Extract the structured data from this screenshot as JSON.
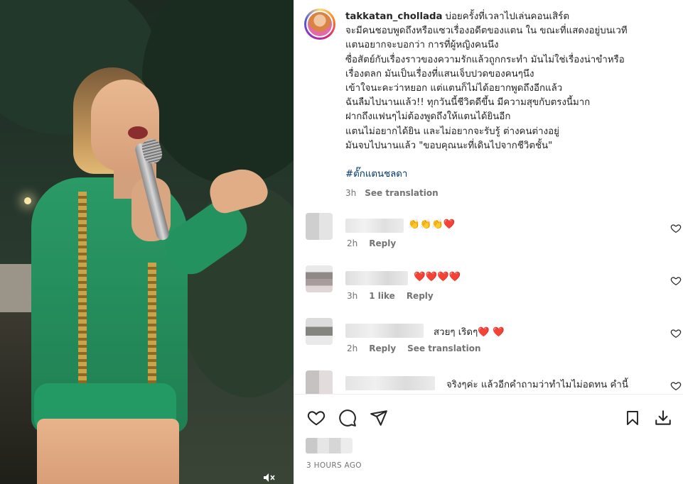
{
  "post": {
    "username": "takkatan_chollada",
    "caption_lines": [
      "บ่อยครั้งที่เวลาไปเล่นคอนเสิร์ต",
      "จะมีคนชอบพูดถึงหรือแซวเรื่องอดีตของแตน ใน ขณะที่แสดงอยู่บนเวที",
      "แตนอยากจะบอกว่า การที่ผู้หญิงคนนึง",
      "ซื่อสัตย์กับเรื่องราวของความรักแล้วถูกกระทำ มันไม่ใช่เรื่องน่าขำหรือ",
      "เรื่องตลก มันเป็นเรื่องที่แสนเจ็บปวดของคนๆนึง",
      "เข้าใจนะคะว่าหยอก แต่แตนก็ไม่ได้อยากพูดถึงอีกแล้ว",
      "ฉันลืมไปนานแล้ว!! ทุกวันนี้ชีวิตดีขึ้น มีความสุขกับตรงนี้มาก",
      "ฝากถึงแฟนๆไม่ต้องพูดถึงให้แตนได้ยินอีก",
      "แตนไม่อยากได้ยิน และไม่อยากจะรับรู้ ต่างคนต่างอยู่",
      "มันจบไปนานแล้ว \"ขอบคุณนะที่เดินไปจากชีวิตชั้น\""
    ],
    "hashtag": "#ตั๊กแตนชลดา",
    "time": "3h",
    "see_translation": "See translation",
    "posted_ago": "3 HOURS AGO"
  },
  "comments": [
    {
      "text": "👏👏👏❤️",
      "time": "2h",
      "likes": "",
      "reply": "Reply",
      "translate": ""
    },
    {
      "text": "❤️❤️❤️❤️",
      "time": "3h",
      "likes": "1 like",
      "reply": "Reply",
      "translate": ""
    },
    {
      "text": "สวยๆ เริดๆ❤️ ❤️",
      "time": "2h",
      "likes": "",
      "reply": "Reply",
      "translate": "See translation"
    },
    {
      "text": "จริงๆค่ะ แล้วอีกคำถามว่าทำไมไม่อดทน คำนี้",
      "time": "",
      "likes": "",
      "reply": "",
      "translate": ""
    }
  ],
  "icons": {
    "like": "heart-outline-icon",
    "comment": "speech-bubble-icon",
    "share": "paper-plane-icon",
    "save": "bookmark-icon",
    "download": "download-icon",
    "mute": "speaker-muted-icon"
  },
  "colors": {
    "text": "#262626",
    "secondary": "#737373",
    "hashtag": "#00376b",
    "heart": "#ed4956",
    "jacket": "#2a9a66"
  }
}
